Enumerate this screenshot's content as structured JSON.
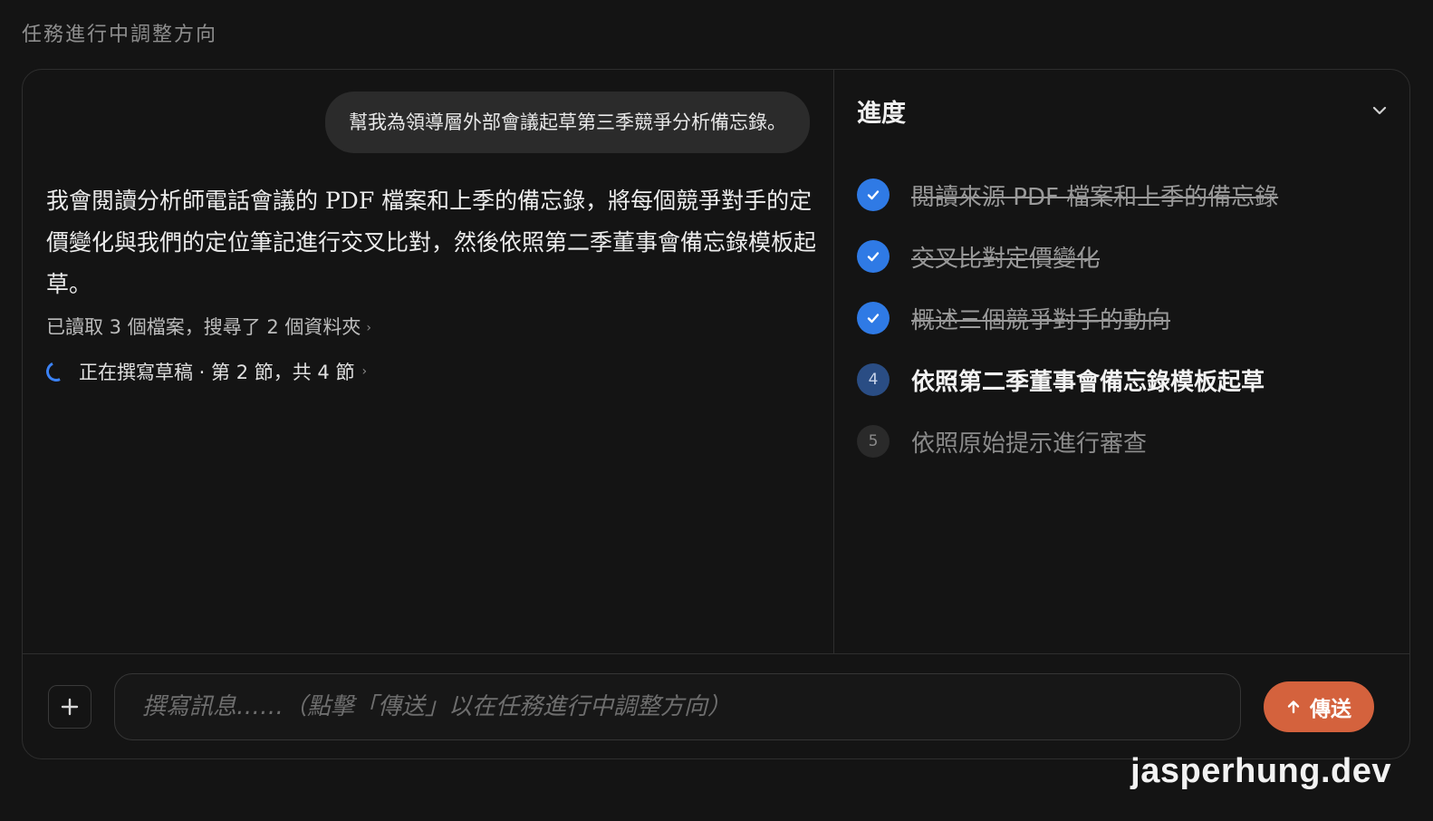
{
  "page": {
    "title": "任務進行中調整方向"
  },
  "chat": {
    "user_message": "幫我為領導層外部會議起草第三季競爭分析備忘錄。",
    "assistant_message": "我會閱讀分析師電話會議的 PDF 檔案和上季的備忘錄，將每個競爭對手的定價變化與我們的定位筆記進行交叉比對，然後依照第二季董事會備忘錄模板起草。",
    "activity_summary": "已讀取 3 個檔案，搜尋了 2 個資料夾",
    "status_text": "正在撰寫草稿 · 第 2 節，共 4 節"
  },
  "progress": {
    "title": "進度",
    "steps": [
      {
        "number": "1",
        "label": "閱讀來源 PDF 檔案和上季的備忘錄",
        "state": "done"
      },
      {
        "number": "2",
        "label": "交叉比對定價變化",
        "state": "done"
      },
      {
        "number": "3",
        "label": "概述三個競爭對手的動向",
        "state": "done"
      },
      {
        "number": "4",
        "label": "依照第二季董事會備忘錄模板起草",
        "state": "current"
      },
      {
        "number": "5",
        "label": "依照原始提示進行審查",
        "state": "pending"
      }
    ]
  },
  "composer": {
    "placeholder": "撰寫訊息……（點擊「傳送」以在任務進行中調整方向）",
    "value": "",
    "send_label": "傳送"
  },
  "watermark": "jasperhung.dev",
  "colors": {
    "background": "#141414",
    "accent_blue": "#2f7ae5",
    "send_orange": "#d4623d"
  },
  "icons": [
    "check-icon",
    "spinner-icon",
    "chevron-right-icon",
    "chevron-down-icon",
    "plus-icon",
    "arrow-up-icon"
  ]
}
